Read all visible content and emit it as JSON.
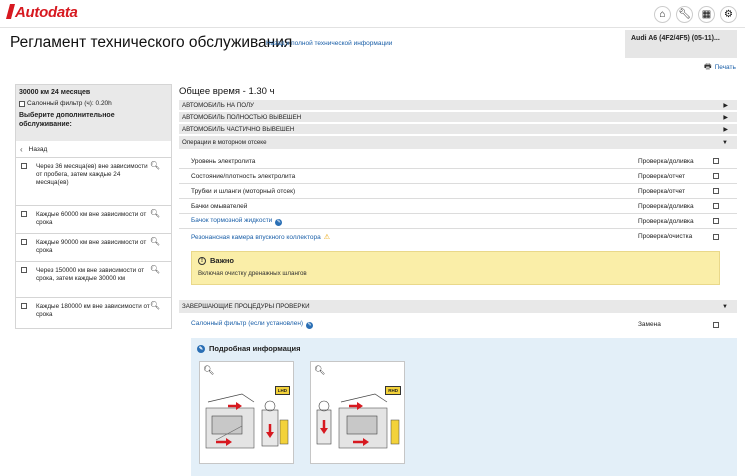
{
  "app": {
    "logo_text": "Autodata",
    "brand_color": "#d71920",
    "accent_color": "#1a5fa8",
    "toolbar_icons": [
      "home-icon",
      "wrench-icon",
      "calculator-icon",
      "gear-icon"
    ]
  },
  "header": {
    "title": "Регламент технического обслуживания",
    "back_link": "Назад к полной технической информации",
    "vehicle": "Audi A6 (4F2/4F5) (05-11)...",
    "print_label": "Печать"
  },
  "left": {
    "interval": "30000 км 24 месяцев",
    "filter_option": "Салонный фильтр (ч): 0.20h",
    "choose_label": "Выберите дополнительное обслуживание:",
    "back_label": "Назад",
    "items": [
      {
        "text": "Через 36 месяца(ев) вне зависимости от пробега, затем каждые 24 месяца(ев)"
      },
      {
        "text": "Каждые 60000 км вне зависимости от срока"
      },
      {
        "text": "Каждые 90000 км вне зависимости от срока"
      },
      {
        "text": "Через 150000 км вне зависимости от срока, затем каждые 30000 км"
      },
      {
        "text": "Каждые 180000 км вне зависимости от срока"
      }
    ]
  },
  "main": {
    "total_time": "Общее время - 1.30 ч",
    "sections": [
      {
        "label": "АВТОМОБИЛЬ НА ПОЛУ"
      },
      {
        "label": "АВТОМОБИЛЬ ПОЛНОСТЬЮ ВЫВЕШЕН"
      },
      {
        "label": "АВТОМОБИЛЬ ЧАСТИЧНО ВЫВЕШЕН"
      }
    ],
    "open_section": "Операции в моторном отсеке",
    "operations": [
      {
        "name": "Уровень электролита",
        "action": "Проверка/доливка"
      },
      {
        "name": "Состояние/плотность электролита",
        "action": "Проверка/отчет"
      },
      {
        "name": "Трубки и шланги (моторный отсек)",
        "action": "Проверка/отчет"
      },
      {
        "name": "Бачки омывателей",
        "action": "Проверка/доливка"
      },
      {
        "name": "Бачок тормозной жидкости",
        "action": "Проверка/доливка"
      },
      {
        "name": "Резонансная камера впускного коллектора",
        "action": "Проверка/очистка"
      }
    ],
    "important_title": "Важно",
    "important_text": "Включая очистку дренажных шлангов",
    "final_section": "ЗАВЕРШАЮЩИЕ ПРОЦЕДУРЫ ПРОВЕРКИ",
    "final_op": {
      "name": "Салонный фильтр (если установлен)",
      "action": "Замена"
    },
    "detail_title": "Подробная информация",
    "images": [
      {
        "badge": "LHD"
      },
      {
        "badge": "RHD"
      }
    ]
  }
}
